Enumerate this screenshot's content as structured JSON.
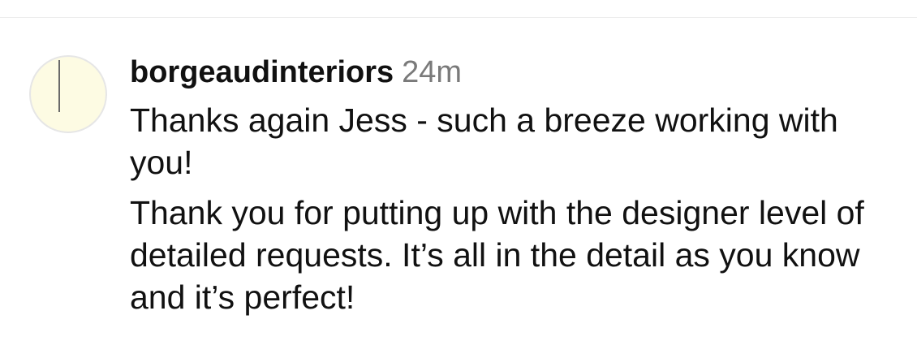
{
  "comment": {
    "username": "borgeaudinteriors",
    "timestamp": "24m",
    "paragraphs": [
      "Thanks again Jess - such a breeze working with you!",
      "Thank you for putting up with the designer level of detailed requests. It’s all in the detail as you know and it’s perfect!"
    ]
  },
  "colors": {
    "avatar_fill": "#fdfbe3",
    "timestamp_text": "#7a7a7a",
    "body_text": "#111111"
  }
}
